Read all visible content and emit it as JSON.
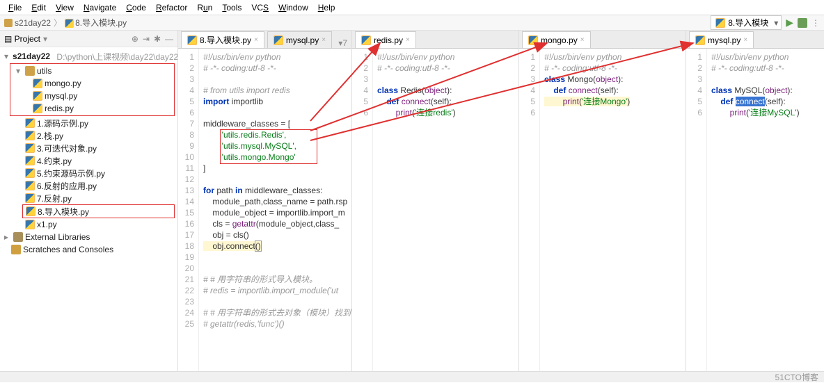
{
  "menubar": [
    "File",
    "Edit",
    "View",
    "Navigate",
    "Code",
    "Refactor",
    "Run",
    "Tools",
    "VCS",
    "Window",
    "Help"
  ],
  "breadcrumbs": {
    "root": "s21day22",
    "file": "8.导入模块.py"
  },
  "run_config": "8.导入模块",
  "sidebar": {
    "title": "Project",
    "project_root": "s21day22",
    "project_path": "D:\\python\\上课视频\\day22\\day22",
    "utils_folder": "utils",
    "utils_files": [
      "mongo.py",
      "mysql.py",
      "redis.py"
    ],
    "files": [
      "1.源码示例.py",
      "2.栈.py",
      "3.可迭代对象.py",
      "4.约束.py",
      "5.约束源码示例.py",
      "6.反射的应用.py",
      "7.反射.py",
      "8.导入模块.py",
      "x1.py"
    ],
    "ext_libs": "External Libraries",
    "scratches": "Scratches and Consoles"
  },
  "tabs": {
    "pane1": [
      {
        "name": "8.导入模块.py",
        "active": true
      },
      {
        "name": "mysql.py",
        "active": false
      }
    ],
    "pane1_counter": "▾7",
    "pane2": {
      "name": "redis.py"
    },
    "pane3": {
      "name": "mongo.py"
    },
    "pane4": {
      "name": "mysql.py"
    }
  },
  "code_main": {
    "lines": [
      "#!/usr/bin/env python",
      "# -*- coding:utf-8 -*-",
      "",
      "# from utils import redis",
      "import importlib",
      "",
      "middleware_classes = [",
      "    'utils.redis.Redis',",
      "    'utils.mysql.MySQL',",
      "    'utils.mongo.Mongo'",
      "]",
      "",
      "for path in middleware_classes:",
      "    module_path,class_name = path.rsp",
      "    module_object = importlib.import_m",
      "    cls = getattr(module_object,class_",
      "    obj = cls()",
      "    obj.connect()",
      "",
      "",
      "# # 用字符串的形式导入模块。",
      "# redis = importlib.import_module('ut",
      "",
      "# # 用字符串的形式去对象（模块）找到他的",
      "# getattr(redis,'func')()",
      ""
    ]
  },
  "code_redis": {
    "lines": [
      "#!/usr/bin/env python",
      "# -*- coding:utf-8 -*-",
      "",
      "class Redis(object):",
      "    def connect(self):",
      "        print('连接redis')"
    ]
  },
  "code_mongo": {
    "lines": [
      "#!/usr/bin/env python",
      "# -*- coding:utf-8 -*-",
      "class Mongo(object):",
      "    def connect(self):",
      "        print('连接Mongo')"
    ]
  },
  "code_mysql": {
    "lines": [
      "#!/usr/bin/env python",
      "# -*- coding:utf-8 -*-",
      "",
      "class MySQL(object):",
      "    def connect(self):",
      "        print('连接MySQL')"
    ]
  },
  "watermark": "51CTO博客"
}
